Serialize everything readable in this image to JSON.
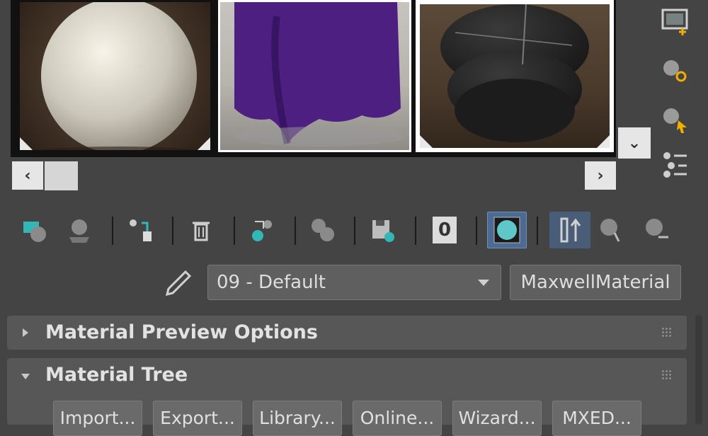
{
  "slots": [
    {
      "name": "sample-slot-1",
      "material": "white sphere"
    },
    {
      "name": "sample-slot-2",
      "material": "purple cloth"
    },
    {
      "name": "sample-slot-3",
      "material": "dark ridged sphere"
    }
  ],
  "icons": {
    "scroll_left": "‹",
    "scroll_right": "›",
    "slots_more": "⌄"
  },
  "toolbar": [
    {
      "name": "get-material-icon",
      "active": false
    },
    {
      "name": "put-to-scene-icon",
      "active": false
    },
    {
      "name": "assign-to-selection-icon",
      "active": false
    },
    {
      "name": "delete-icon",
      "active": false
    },
    {
      "name": "make-unique-icon",
      "active": false
    },
    {
      "name": "put-to-library-icon",
      "active": false
    },
    {
      "name": "save-icon",
      "active": false
    },
    {
      "name": "material-id-channel-icon",
      "active": false,
      "label": "0"
    },
    {
      "name": "show-shaded-material-icon",
      "active": true
    },
    {
      "name": "show-end-result-icon",
      "active": true
    },
    {
      "name": "go-to-parent-icon",
      "active": false
    },
    {
      "name": "go-forward-to-sibling-icon",
      "active": false
    }
  ],
  "material_name": "09 - Default",
  "material_type": "MaxwellMaterial",
  "rollouts": [
    {
      "title": "Material Preview Options",
      "expanded": false
    },
    {
      "title": "Material Tree",
      "expanded": true
    }
  ],
  "tree_buttons": [
    "Import...",
    "Export...",
    "Library...",
    "Online...",
    "Wizard...",
    "MXED..."
  ],
  "colors": {
    "accent": "#4d6a92",
    "panel": "#444444",
    "rollout": "#575757"
  }
}
